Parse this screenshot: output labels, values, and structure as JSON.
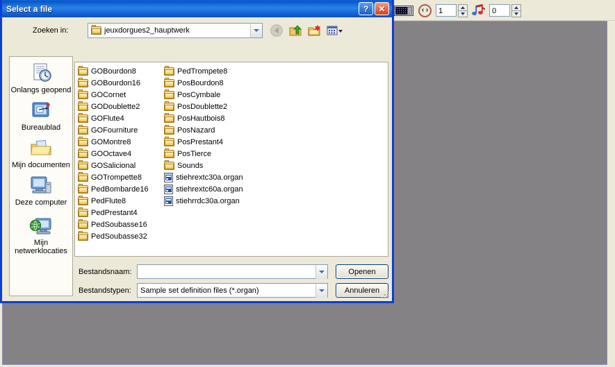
{
  "dialog": {
    "title": "Select a file",
    "help_button": "?",
    "close_button": "✕",
    "lookin": {
      "label": "Zoeken in:",
      "value": "jeuxdorgues2_hauptwerk",
      "folder_icon": "open-folder-icon"
    },
    "nav_icons": [
      {
        "name": "back-icon",
        "enabled": false
      },
      {
        "name": "up-one-level-icon",
        "enabled": true
      },
      {
        "name": "new-folder-icon",
        "enabled": true
      },
      {
        "name": "views-dropdown-icon",
        "enabled": true
      }
    ],
    "places": [
      {
        "label": "Onlangs geopend",
        "icon": "recent-documents-icon"
      },
      {
        "label": "Bureaublad",
        "icon": "desktop-icon"
      },
      {
        "label": "Mijn documenten",
        "icon": "my-documents-icon"
      },
      {
        "label": "Deze computer",
        "icon": "my-computer-icon"
      },
      {
        "label": "Mijn netwerklocaties",
        "icon": "network-places-icon"
      }
    ],
    "file_list": {
      "columns": [
        [
          {
            "name": "GOBourdon8",
            "type": "folder"
          },
          {
            "name": "GOBourdon16",
            "type": "folder"
          },
          {
            "name": "GOCornet",
            "type": "folder"
          },
          {
            "name": "GODoublette2",
            "type": "folder"
          },
          {
            "name": "GOFlute4",
            "type": "folder"
          },
          {
            "name": "GOFourniture",
            "type": "folder"
          },
          {
            "name": "GOMontre8",
            "type": "folder"
          },
          {
            "name": "GOOctave4",
            "type": "folder"
          },
          {
            "name": "GOSalicional",
            "type": "folder"
          },
          {
            "name": "GOTrompette8",
            "type": "folder"
          },
          {
            "name": "PedBombarde16",
            "type": "folder"
          },
          {
            "name": "PedFlute8",
            "type": "folder"
          },
          {
            "name": "PedPrestant4",
            "type": "folder"
          },
          {
            "name": "PedSoubasse16",
            "type": "folder"
          },
          {
            "name": "PedSoubasse32",
            "type": "folder"
          }
        ],
        [
          {
            "name": "PedTrompete8",
            "type": "folder"
          },
          {
            "name": "PosBourdon8",
            "type": "folder"
          },
          {
            "name": "PosCymbale",
            "type": "folder"
          },
          {
            "name": "PosDoublette2",
            "type": "folder"
          },
          {
            "name": "PosHautbois8",
            "type": "folder"
          },
          {
            "name": "PosNazard",
            "type": "folder"
          },
          {
            "name": "PosPrestant4",
            "type": "folder"
          },
          {
            "name": "PosTierce",
            "type": "folder"
          },
          {
            "name": "Sounds",
            "type": "folder"
          },
          {
            "name": "stiehrextc30a.organ",
            "type": "file"
          },
          {
            "name": "stiehrextc60a.organ",
            "type": "file"
          },
          {
            "name": "stiehrrdc30a.organ",
            "type": "file"
          }
        ]
      ]
    },
    "filename": {
      "label": "Bestandsnaam:",
      "value": "",
      "placeholder": ""
    },
    "filetype": {
      "label": "Bestandstypen:",
      "value": "Sample set definition files (*.organ)"
    },
    "buttons": {
      "open": "Openen",
      "cancel": "Annuleren"
    }
  },
  "background_app": {
    "toolbar": {
      "keyboard_icon": "organ-manual-icon",
      "transpose_icon": "transpose-icon",
      "transpose_glyph": "‹›",
      "transpose_value": "1",
      "polyphony_icon": "music-notes-icon",
      "polyphony_value": "0"
    },
    "client_color": "#848284"
  },
  "colors": {
    "titlebar_blue": "#0a56c8",
    "dialog_border": "#0a3fd4",
    "dialog_face": "#ece9d8",
    "list_bg": "#ffffff",
    "places_bg": "#fdfcf7",
    "folder_gold": "#e8b64a",
    "accent_red": "#d8421a",
    "client_grey": "#848284"
  }
}
